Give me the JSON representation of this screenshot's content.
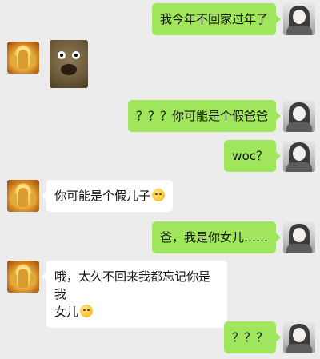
{
  "messages": [
    {
      "side": "right",
      "text": "我今年不回家过年了"
    },
    {
      "side": "left",
      "type": "sticker",
      "sticker": "surprised-gopher-sticker"
    },
    {
      "side": "right",
      "text": "？？？你可能是个假爸爸"
    },
    {
      "side": "right",
      "text": "woc？"
    },
    {
      "side": "left",
      "text": "你可能是个假儿子",
      "emoji": "smile-emoji"
    },
    {
      "side": "right",
      "text": "爸，我是你女儿……"
    },
    {
      "side": "left",
      "lines": [
        "哦，太久不回来我都忘记你是我",
        "女儿"
      ],
      "emoji": "smile-emoji"
    },
    {
      "side": "right",
      "text": "？？？"
    }
  ]
}
